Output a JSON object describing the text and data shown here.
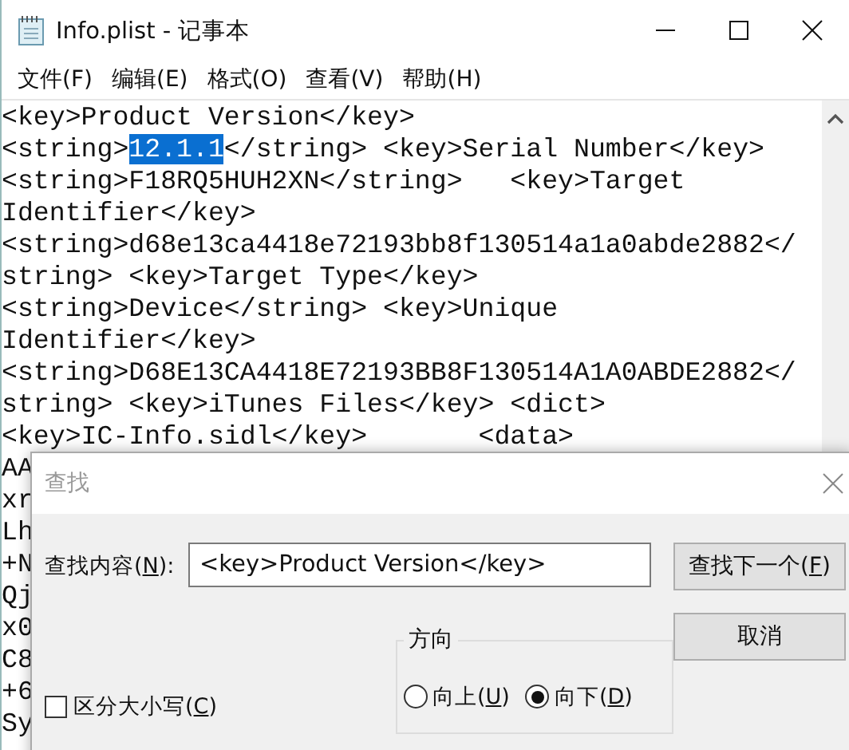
{
  "window": {
    "title": "Info.plist - 记事本"
  },
  "menu": [
    "文件(F)",
    "编辑(E)",
    "格式(O)",
    "查看(V)",
    "帮助(H)"
  ],
  "editor": {
    "lines": [
      [
        {
          "text": "<key>Product Version</key>",
          "selected": false
        }
      ],
      [
        {
          "text": "<string>",
          "selected": false
        },
        {
          "text": "12.1.1",
          "selected": true
        },
        {
          "text": "</string> <key>Serial Number</key>",
          "selected": false
        }
      ],
      [
        {
          "text": "<string>F18RQ5HUH2XN</string>   <key>Target",
          "selected": false
        }
      ],
      [
        {
          "text": "Identifier</key>",
          "selected": false
        }
      ],
      [
        {
          "text": "<string>d68e13ca4418e72193bb8f130514a1a0abde2882</",
          "selected": false
        }
      ],
      [
        {
          "text": "string> <key>Target Type</key>",
          "selected": false
        }
      ],
      [
        {
          "text": "<string>Device</string> <key>Unique",
          "selected": false
        }
      ],
      [
        {
          "text": "Identifier</key>",
          "selected": false
        }
      ],
      [
        {
          "text": "<string>D68E13CA4418E72193BB8F130514A1A0ABDE2882</",
          "selected": false
        }
      ],
      [
        {
          "text": "string> <key>iTunes Files</key> <dict>",
          "selected": false
        }
      ],
      [
        {
          "text": "<key>IC-Info.sidl</key>       <data>",
          "selected": false
        }
      ],
      [
        {
          "text": "AA",
          "selected": false
        }
      ],
      [
        {
          "text": "xr",
          "selected": false
        }
      ],
      [
        {
          "text": "Lh",
          "selected": false
        }
      ],
      [
        {
          "text": "+N",
          "selected": false
        }
      ],
      [
        {
          "text": "Qj",
          "selected": false
        }
      ],
      [
        {
          "text": "x0",
          "selected": false
        }
      ],
      [
        {
          "text": "C8",
          "selected": false
        }
      ],
      [
        {
          "text": "+6",
          "selected": false
        }
      ],
      [
        {
          "text": "Sy",
          "selected": false
        }
      ]
    ]
  },
  "find_dialog": {
    "title": "查找",
    "find_label": {
      "before": "查找内容(",
      "mnemonic": "N",
      "after": "):"
    },
    "find_field": {
      "value": "<key>Product Version</key>"
    },
    "buttons": [
      {
        "before": "查找下一个(",
        "mnemonic": "F",
        "after": ")"
      },
      {
        "before": "取消"
      }
    ],
    "direction": {
      "title": "方向",
      "options": [
        {
          "before": "向上(",
          "mnemonic": "U",
          "after": ")",
          "selected": false
        },
        {
          "before": "向下(",
          "mnemonic": "D",
          "after": ")",
          "selected": true
        }
      ]
    },
    "match_case": {
      "before": "区分大小写(",
      "mnemonic": "C",
      "after": ")",
      "checked": false
    }
  }
}
